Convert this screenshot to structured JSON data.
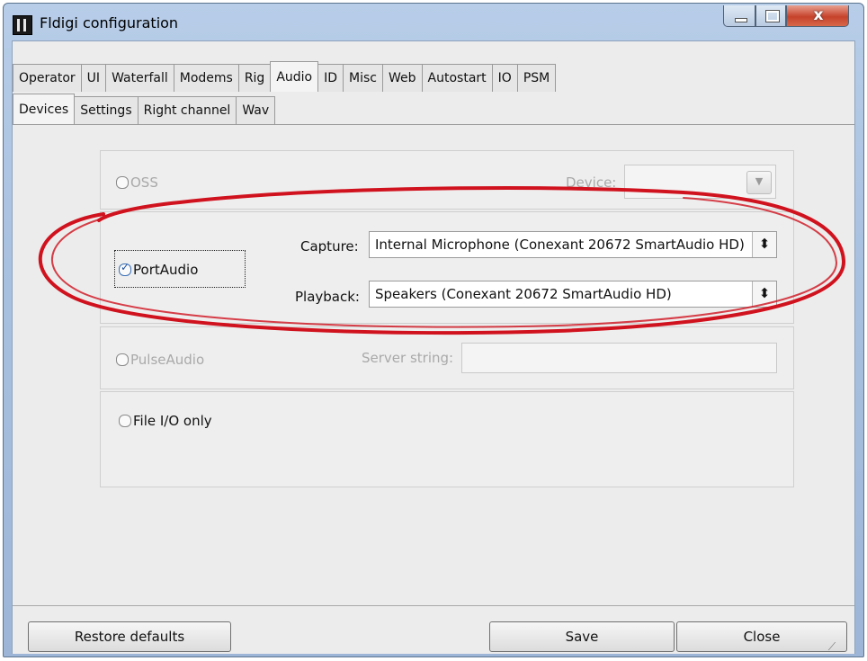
{
  "window": {
    "title": "Fldigi configuration",
    "close_glyph": "x"
  },
  "tabs_main": [
    {
      "label": "Operator"
    },
    {
      "label": "UI"
    },
    {
      "label": "Waterfall"
    },
    {
      "label": "Modems"
    },
    {
      "label": "Rig"
    },
    {
      "label": "Audio",
      "active": true
    },
    {
      "label": "ID"
    },
    {
      "label": "Misc"
    },
    {
      "label": "Web"
    },
    {
      "label": "Autostart"
    },
    {
      "label": "IO"
    },
    {
      "label": "PSM"
    }
  ],
  "tabs_sub": [
    {
      "label": "Devices",
      "active": true
    },
    {
      "label": "Settings"
    },
    {
      "label": "Right channel"
    },
    {
      "label": "Wav"
    }
  ],
  "oss": {
    "label": "OSS",
    "checked": false,
    "enabled": false,
    "device_label": "Device:",
    "device_value": ""
  },
  "portaudio": {
    "label": "PortAudio",
    "checked": true,
    "capture_label": "Capture:",
    "capture_value": "Internal Microphone (Conexant 20672 SmartAudio HD)",
    "playback_label": "Playback:",
    "playback_value": "Speakers (Conexant 20672 SmartAudio HD)"
  },
  "pulseaudio": {
    "label": "PulseAudio",
    "checked": false,
    "enabled": false,
    "server_label": "Server string:",
    "server_value": ""
  },
  "fileio": {
    "label": "File I/O only",
    "checked": false
  },
  "buttons": {
    "restore": "Restore defaults",
    "save": "Save",
    "close": "Close"
  },
  "colors": {
    "annotation_ring": "#d0121e",
    "titlebar": "#a9c1e0",
    "close_button": "#c6422b"
  }
}
